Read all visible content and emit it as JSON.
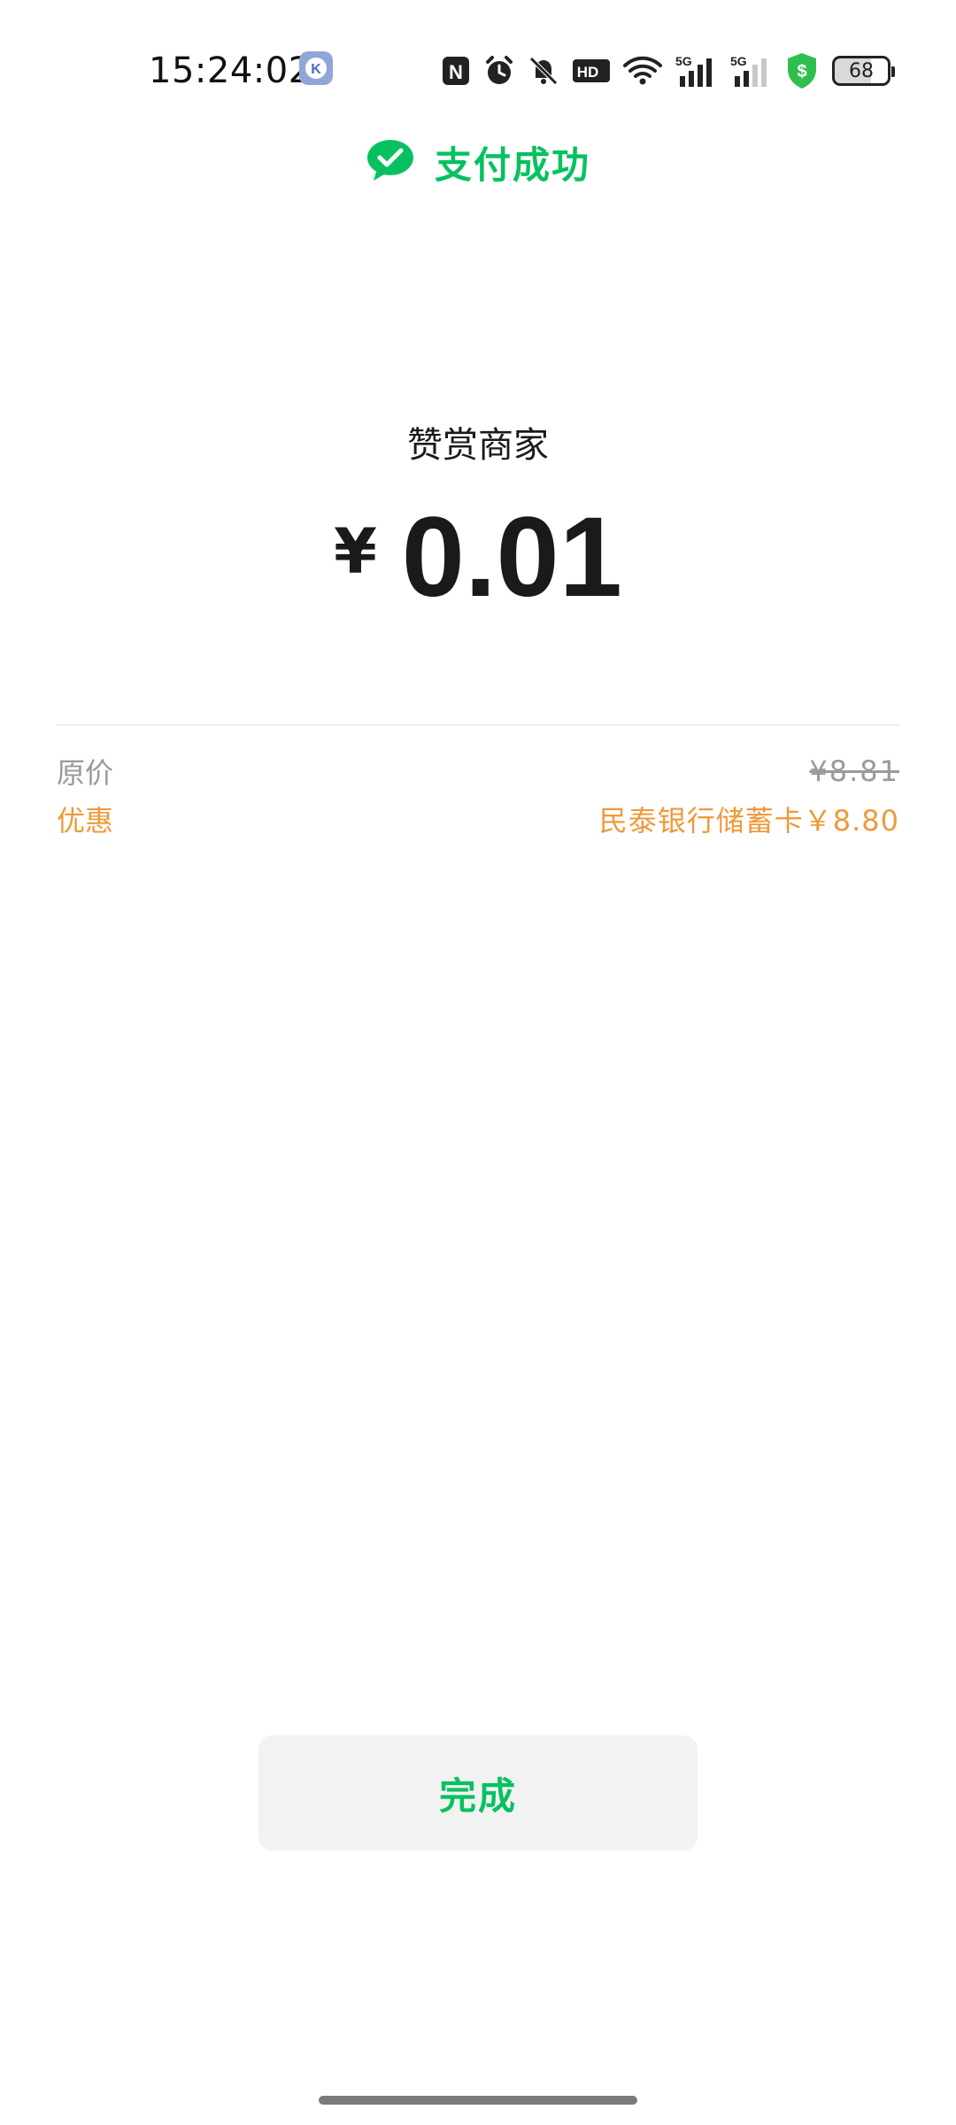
{
  "status_bar": {
    "time": "15:24:02",
    "app_badge_letter": "K",
    "nfc_letter": "N",
    "hd_label": "HD",
    "net_label_1": "5G",
    "net_label_2": "5G",
    "battery_level": "68",
    "shield_symbol": "$"
  },
  "header": {
    "title": "支付成功",
    "icon": "wechat-pay-check-icon",
    "color": "#07c160"
  },
  "payment": {
    "merchant": "赞赏商家",
    "currency_symbol": "¥",
    "amount": "0.01"
  },
  "details": {
    "original_label": "原价",
    "original_value": "¥8.81",
    "discount_label": "优惠",
    "discount_value": "民泰银行储蓄卡￥8.80",
    "discount_color": "#ee9a3a"
  },
  "actions": {
    "done_label": "完成"
  }
}
